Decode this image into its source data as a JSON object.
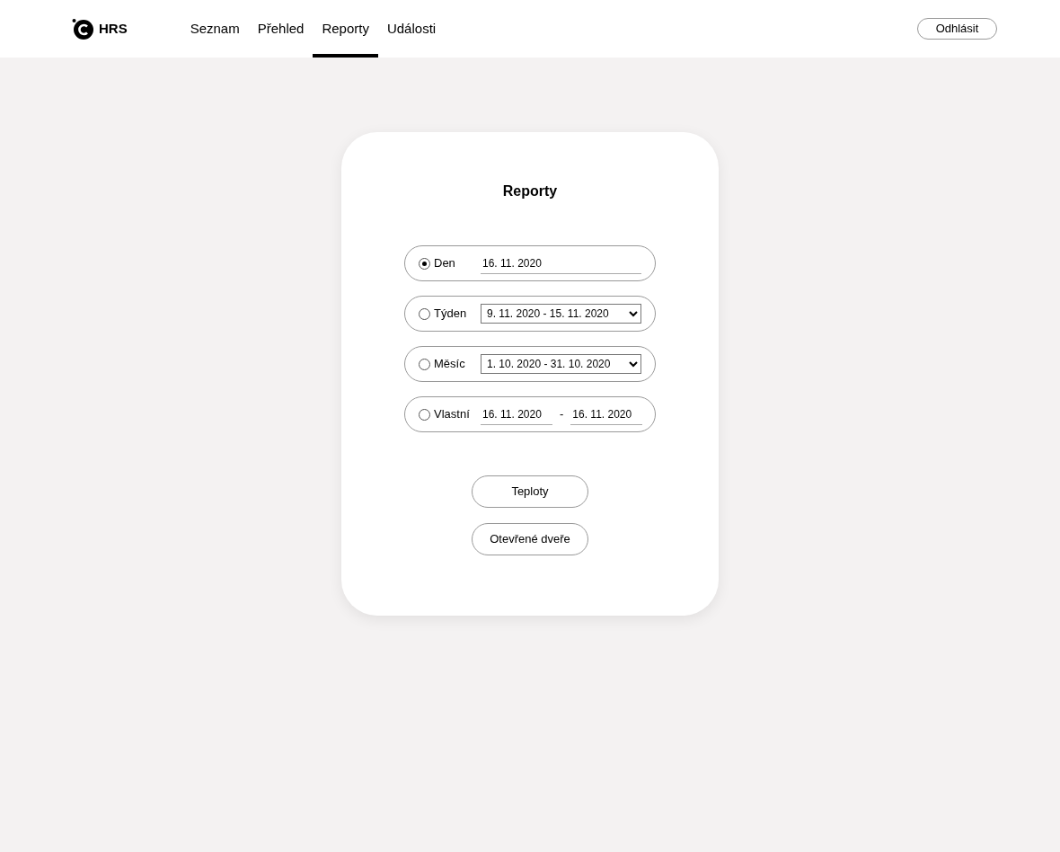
{
  "brand": {
    "name": "HRS"
  },
  "nav": [
    {
      "label": "Seznam",
      "selected": false
    },
    {
      "label": "Přehled",
      "selected": false
    },
    {
      "label": "Reporty",
      "selected": true
    },
    {
      "label": "Události",
      "selected": false
    }
  ],
  "logout": "Odhlásit",
  "card": {
    "title": "Reporty",
    "periods": [
      {
        "kind": "date",
        "label": "Den",
        "selected": true,
        "value": "16. 11. 2020"
      },
      {
        "kind": "select",
        "label": "Týden",
        "selected": false,
        "value": "9. 11. 2020 - 15. 11. 2020"
      },
      {
        "kind": "select",
        "label": "Měsíc",
        "selected": false,
        "value": "1. 10. 2020 - 31. 10. 2020"
      },
      {
        "kind": "range",
        "label": "Vlastní",
        "selected": false,
        "from": "16. 11. 2020",
        "separator": "-",
        "to": "16. 11. 2020"
      }
    ],
    "buttons": [
      "Teploty",
      "Otevřené dveře"
    ]
  }
}
